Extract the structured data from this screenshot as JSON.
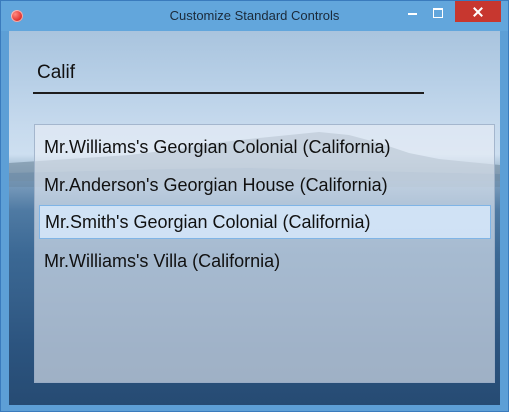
{
  "window": {
    "title": "Customize Standard Controls"
  },
  "search": {
    "value": "Calif"
  },
  "results": {
    "items": [
      {
        "label": "Mr.Williams's Georgian Colonial (California)"
      },
      {
        "label": "Mr.Anderson's Georgian House (California)"
      },
      {
        "label": "Mr.Smith's Georgian Colonial (California)"
      },
      {
        "label": "Mr.Williams's Villa (California)"
      }
    ],
    "selected_index": 2
  },
  "colors": {
    "titlebar": "#62a6dc",
    "close_button": "#c7372f",
    "selection_border": "#7fb4e6"
  }
}
